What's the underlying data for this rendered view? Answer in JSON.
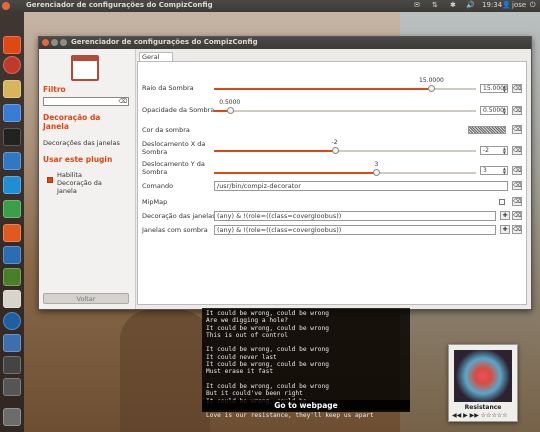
{
  "top_panel": {
    "title": "Gerenciador de configurações do CompizConfig",
    "user": "jose",
    "time": "19:34"
  },
  "window": {
    "title": "Gerenciador de configurações do CompizConfig"
  },
  "sidebar": {
    "filter_heading": "Filtro",
    "filter_value": "",
    "category_heading": "Decoração da Janela",
    "category_item": "Decorações das janelas",
    "use_plugin_heading": "Usar este plugin",
    "enable_label": "Habilita Decoração da Janela",
    "enable_checked": true,
    "back_button": "Voltar"
  },
  "tabs": [
    "Geral"
  ],
  "settings": {
    "shadow_radius": {
      "label": "Raio da Sombra",
      "value": "15.0000",
      "slider_text": "15.0000",
      "fraction": 0.83
    },
    "shadow_opacity": {
      "label": "Opacidade da Sombra",
      "value": "0.5000",
      "slider_text": "0.5000",
      "fraction": 0.06
    },
    "shadow_color": {
      "label": "Cor da sombra"
    },
    "shadow_offset_x": {
      "label": "Deslocamento X da Sombra",
      "value": "-2",
      "slider_text": "-2",
      "fraction": 0.46
    },
    "shadow_offset_y": {
      "label": "Deslocamento Y da Sombra",
      "value": "3",
      "slider_text": "3",
      "fraction": 0.62
    },
    "command": {
      "label": "Comando",
      "value": "/usr/bin/compiz-decorator"
    },
    "mipmap": {
      "label": "MipMap",
      "checked": false
    },
    "window_decoration": {
      "label": "Decoração das janelas",
      "value": "(any) & !(role=((class=covergloobus))"
    },
    "shadow_windows": {
      "label": "Janelas com sombra",
      "value": "(any) & !(role=((class=covergloobus))"
    }
  },
  "lyrics": [
    "It could be wrong, could be wrong",
    "Are we digging a hole?",
    "It could be wrong, could be wrong",
    "This is out of control",
    "",
    "It could be wrong, could be wrong",
    "It could never last",
    "It could be wrong, could be wrong",
    "Must erase it fast",
    "",
    "It could be wrong, could be wrong",
    "But it could've been right",
    "It could be wrong, could be",
    "",
    "Love is our resistance, they'll keep us apart"
  ],
  "goto_label": "Go to webpage",
  "album": {
    "title": "Resistance",
    "controls": "◀◀ ▶ ▶▶ ☆☆☆☆☆"
  }
}
